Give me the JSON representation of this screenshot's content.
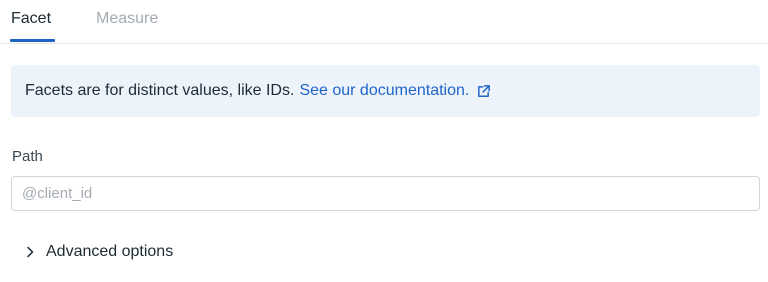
{
  "tabs": {
    "facet_label": "Facet",
    "measure_label": "Measure",
    "active": "Facet"
  },
  "info": {
    "text": "Facets are for distinct values, like IDs.",
    "link_text": "See our documentation.",
    "link_icon": "external-link-icon"
  },
  "path": {
    "label": "Path",
    "value": "",
    "placeholder": "@client_id"
  },
  "advanced": {
    "label": "Advanced options",
    "icon": "chevron-right-icon"
  },
  "colors": {
    "accent": "#1f65c7",
    "info_background": "#edf3fa",
    "inactive_tab": "#a5abb2"
  }
}
